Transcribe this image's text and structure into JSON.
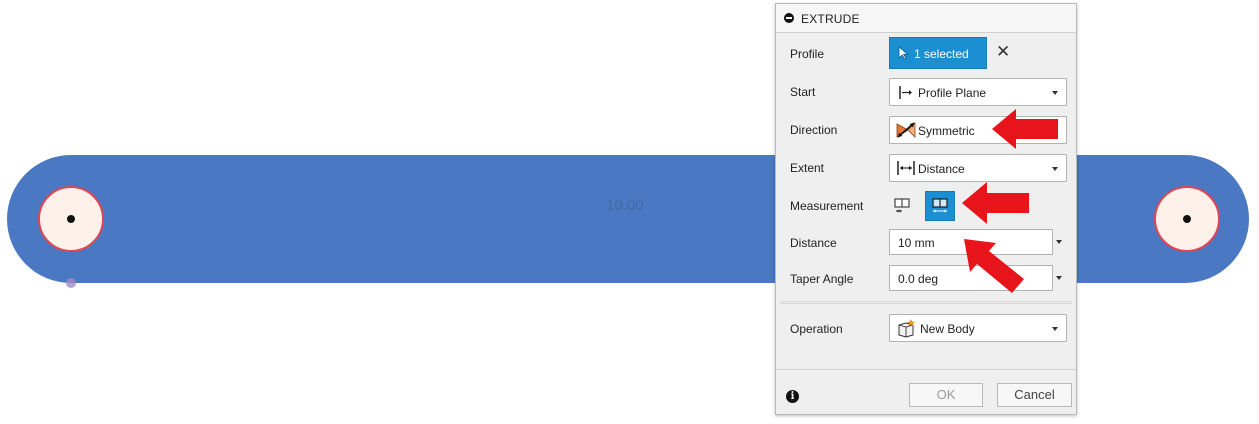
{
  "viewport": {
    "dimension_label": "10.00",
    "colors": {
      "body": "#4a78c3",
      "hole_outline": "#e04552",
      "hole_fill": "#fdf1ea",
      "dimension_text": "#4468a8",
      "annotation_arrow": "#e8141b"
    }
  },
  "dialog": {
    "title": "EXTRUDE",
    "profile": {
      "label": "Profile",
      "value": "1 selected",
      "clear_symbol": "✕"
    },
    "start": {
      "label": "Start",
      "value": "Profile Plane",
      "icon": "profile-plane-icon"
    },
    "direction": {
      "label": "Direction",
      "value": "Symmetric",
      "icon": "symmetric-icon"
    },
    "extent": {
      "label": "Extent",
      "value": "Distance",
      "icon": "distance-icon"
    },
    "measurement": {
      "label": "Measurement",
      "options": [
        "half-length-icon",
        "whole-length-icon"
      ],
      "selected": "whole-length-icon"
    },
    "distance": {
      "label": "Distance",
      "value": "10 mm"
    },
    "taper": {
      "label": "Taper Angle",
      "value": "0.0 deg"
    },
    "operation": {
      "label": "Operation",
      "value": "New Body",
      "icon": "new-body-icon"
    },
    "footer": {
      "info_symbol": "i",
      "ok": "OK",
      "cancel": "Cancel"
    },
    "accent_color": "#1b8fd2"
  }
}
